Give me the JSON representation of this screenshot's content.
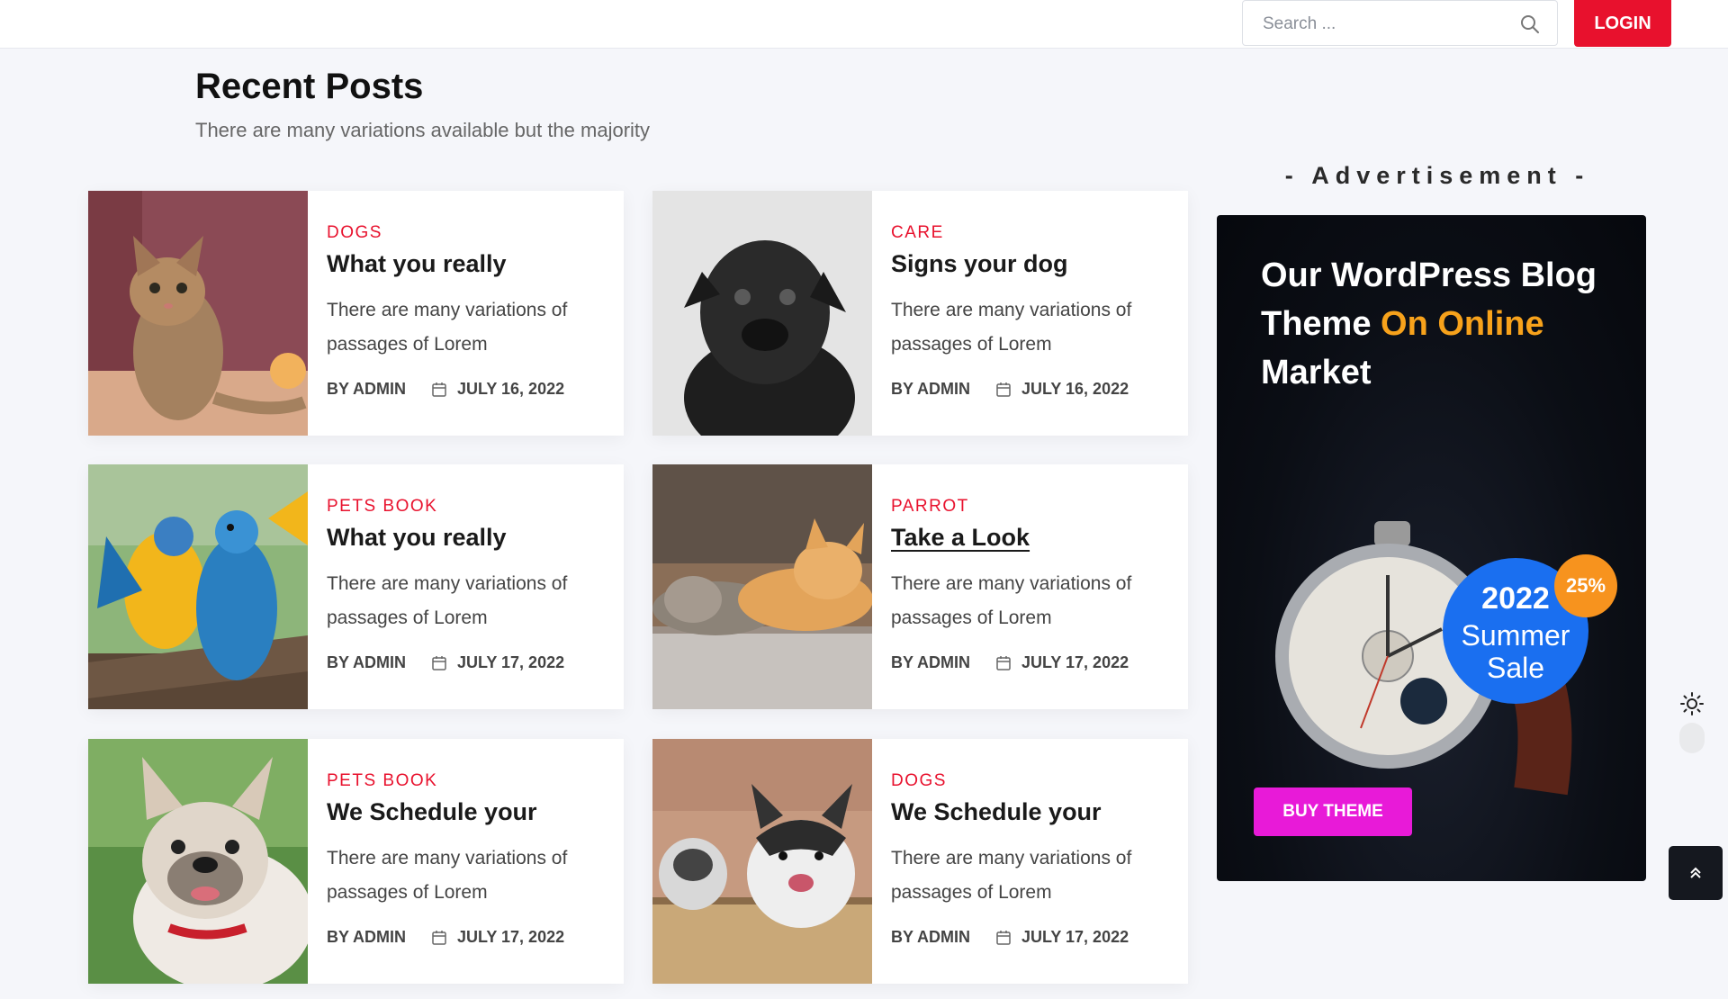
{
  "header": {
    "search": {
      "placeholder": "Search ...",
      "value": ""
    },
    "login_label": "LOGIN"
  },
  "recent": {
    "title": "Recent Posts",
    "subtitle": "There are many variations available but the majority"
  },
  "posts": [
    {
      "category": "DOGS",
      "title": "What you really",
      "excerpt": "There are many variations of passages of Lorem",
      "author": "BY ADMIN",
      "date": "JULY 16, 2022",
      "image": "kitten"
    },
    {
      "category": "CARE",
      "title": "Signs your dog",
      "excerpt": "There are many variations of passages of Lorem",
      "author": "BY ADMIN",
      "date": "JULY 16, 2022",
      "image": "pug"
    },
    {
      "category": "PETS BOOK",
      "title": "What you really",
      "excerpt": "There are many variations of passages of Lorem",
      "author": "BY ADMIN",
      "date": "JULY 17, 2022",
      "image": "parrots"
    },
    {
      "category": "PARROT",
      "title": "Take a Look",
      "excerpt": "There are many variations of passages of Lorem",
      "author": "BY ADMIN",
      "date": "JULY 17, 2022",
      "image": "cats"
    },
    {
      "category": "PETS BOOK",
      "title": "We Schedule your",
      "excerpt": "There are many variations of passages of Lorem",
      "author": "BY ADMIN",
      "date": "JULY 17, 2022",
      "image": "bulldog"
    },
    {
      "category": "DOGS",
      "title": "We Schedule your",
      "excerpt": "There are many variations of passages of Lorem",
      "author": "BY ADMIN",
      "date": "JULY 17, 2022",
      "image": "husky"
    }
  ],
  "ad": {
    "label": "- Advertisement -",
    "headline_part1": "Our WordPress Blog Theme ",
    "headline_highlight": "On Online",
    "headline_part2": " Market",
    "sale_year": "2022",
    "sale_line1": "Summer",
    "sale_line2": "Sale",
    "discount": "25%",
    "button_label": "BUY THEME"
  },
  "colors": {
    "accent": "#e8112d",
    "ad_highlight": "#f7a21b",
    "sale_blue": "#1a6ff0",
    "buy_button": "#e81ad8"
  },
  "icons": {
    "search": "search-icon",
    "calendar": "calendar-icon",
    "theme_toggle": "sun-icon",
    "scroll_top": "chevron-double-up-icon"
  }
}
